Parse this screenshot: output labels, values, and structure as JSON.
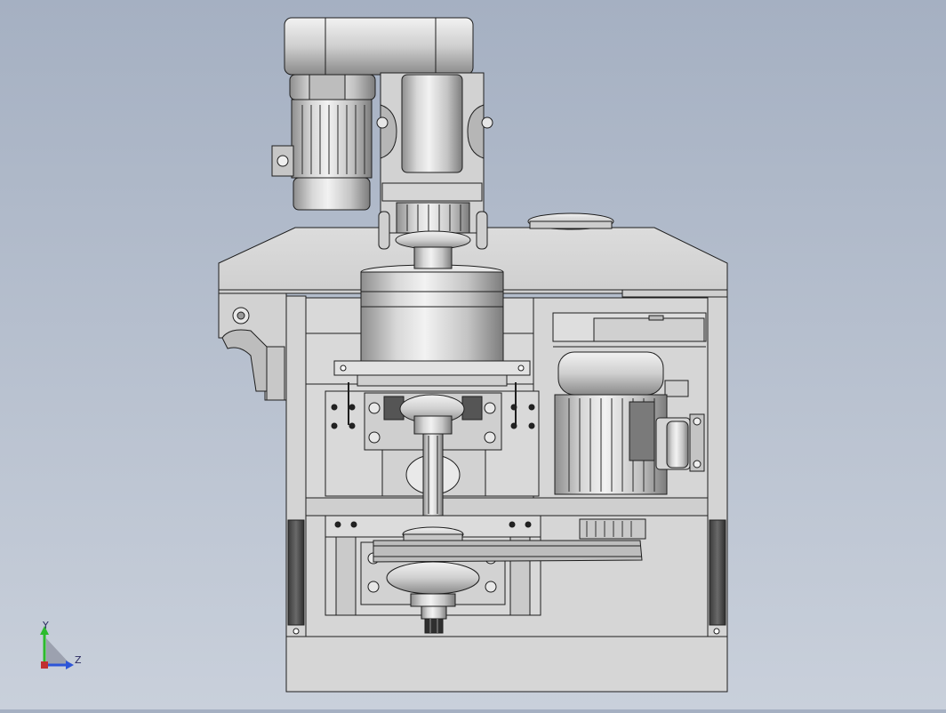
{
  "view": {
    "background_top": "#a5b0c2",
    "background_bottom": "#c9d0db",
    "edge_color": "#1e1e1e",
    "metal_light": "#e4e4e4",
    "metal_mid": "#c8c8c8",
    "metal_dark": "#8c8c8c"
  },
  "triad": {
    "y_label": "Y",
    "z_label": "Z",
    "y_axis_color": "#2dbb2d",
    "z_axis_color": "#2d55d8",
    "origin_color": "#c03030",
    "x_hint_color": "#8a8f9c"
  }
}
